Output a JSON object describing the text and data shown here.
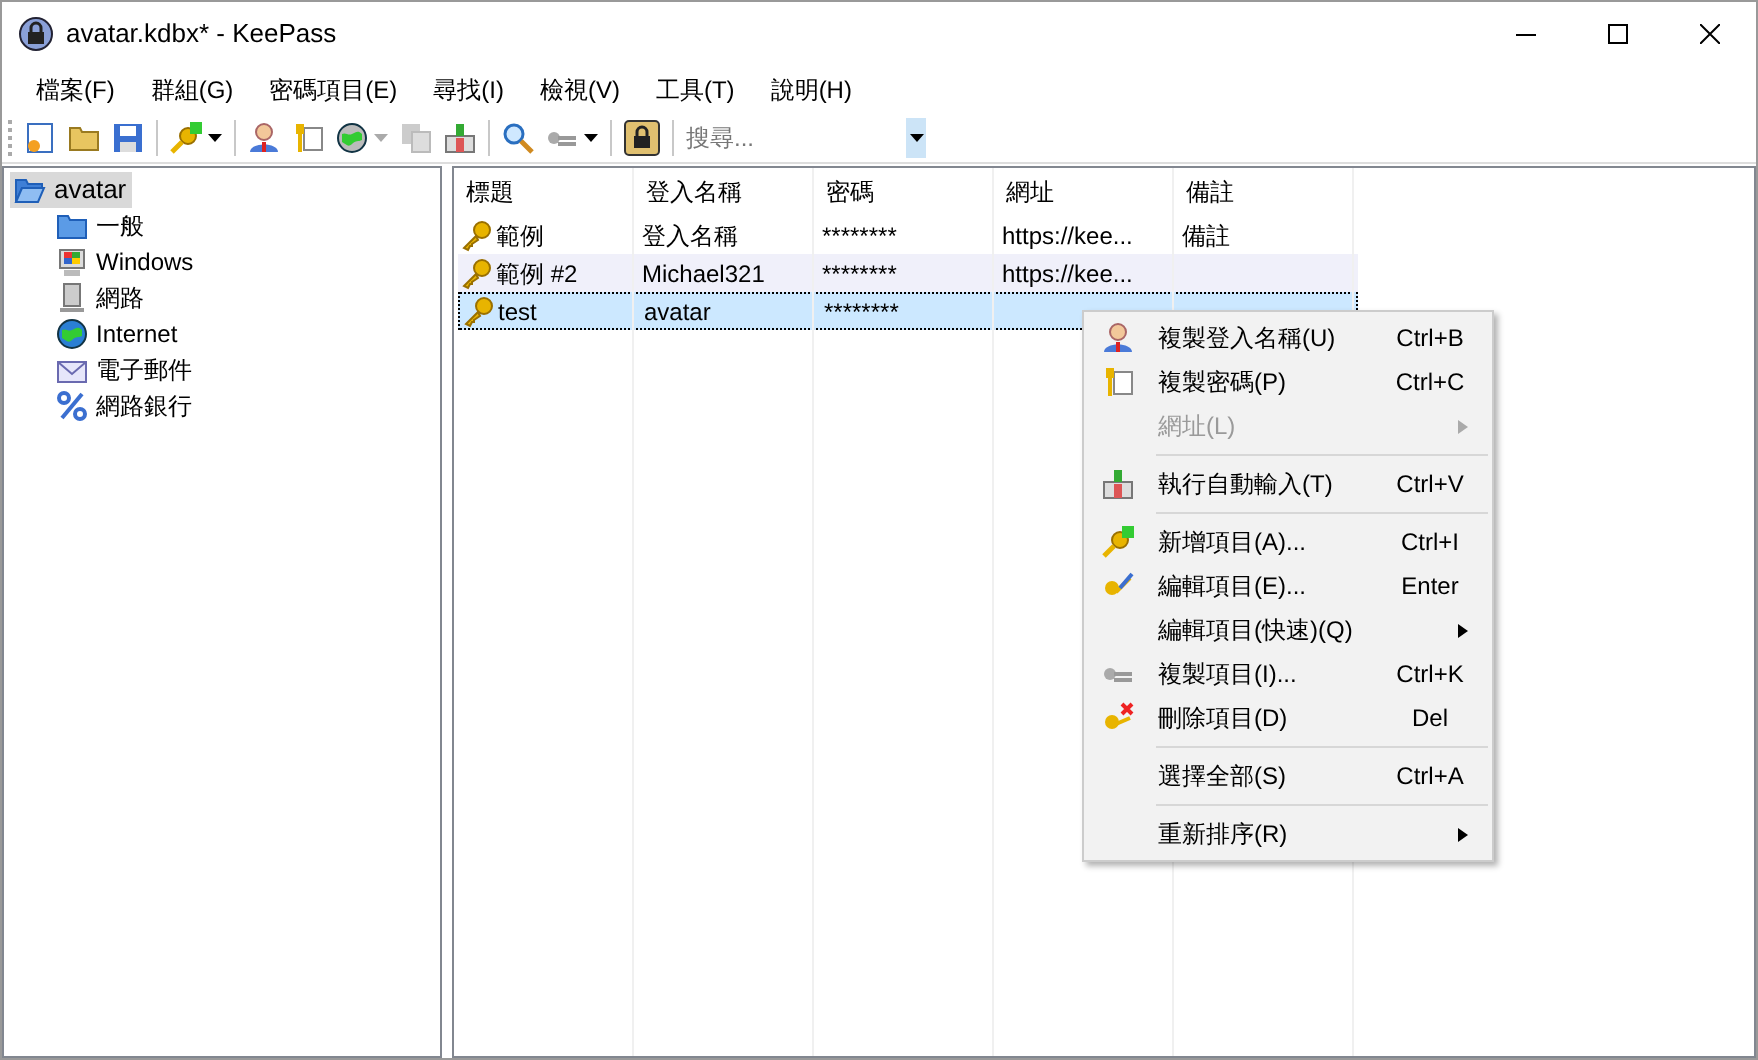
{
  "window": {
    "title": "avatar.kdbx* - KeePass"
  },
  "menu": [
    "檔案(F)",
    "群組(G)",
    "密碼項目(E)",
    "尋找(I)",
    "檢視(V)",
    "工具(T)",
    "說明(H)"
  ],
  "search": {
    "placeholder": "搜尋..."
  },
  "tree": {
    "label": "avatar",
    "selected": true,
    "expanded": true,
    "children": [
      {
        "label": "一般",
        "selected": false
      },
      {
        "label": "Windows",
        "selected": false
      },
      {
        "label": "網路",
        "selected": false
      },
      {
        "label": "Internet",
        "selected": false
      },
      {
        "label": "電子郵件",
        "selected": false
      },
      {
        "label": "網路銀行",
        "selected": false
      }
    ]
  },
  "table": {
    "columns": [
      "標題",
      "登入名稱",
      "密碼",
      "網址",
      "備註"
    ],
    "rows": [
      {
        "selected": false,
        "cells": [
          "範例",
          "登入名稱",
          "********",
          "https://kee...",
          "備註"
        ]
      },
      {
        "selected": false,
        "cells": [
          "範例 #2",
          "Michael321",
          "********",
          "https://kee...",
          ""
        ]
      },
      {
        "selected": true,
        "cells": [
          "test",
          "avatar",
          "********",
          "",
          ""
        ]
      }
    ]
  },
  "context_menu": [
    {
      "kind": "item",
      "label": "複製登入名稱(U)",
      "shortcut": "Ctrl+B",
      "disabled": false,
      "submenu": false
    },
    {
      "kind": "item",
      "label": "複製密碼(P)",
      "shortcut": "Ctrl+C",
      "disabled": false,
      "submenu": false
    },
    {
      "kind": "item",
      "label": "網址(L)",
      "disabled": true,
      "submenu": true
    },
    {
      "kind": "separator"
    },
    {
      "kind": "item",
      "label": "執行自動輸入(T)",
      "shortcut": "Ctrl+V",
      "disabled": false,
      "submenu": false
    },
    {
      "kind": "separator"
    },
    {
      "kind": "item",
      "label": "新增項目(A)...",
      "shortcut": "Ctrl+I",
      "disabled": false,
      "submenu": false
    },
    {
      "kind": "item",
      "label": "編輯項目(E)...",
      "shortcut": "Enter",
      "disabled": false,
      "submenu": false
    },
    {
      "kind": "item",
      "label": "編輯項目(快速)(Q)",
      "disabled": false,
      "submenu": true
    },
    {
      "kind": "item",
      "label": "複製項目(I)...",
      "shortcut": "Ctrl+K",
      "disabled": false,
      "submenu": false
    },
    {
      "kind": "item",
      "label": "刪除項目(D)",
      "shortcut": "Del",
      "disabled": false,
      "submenu": false
    },
    {
      "kind": "separator"
    },
    {
      "kind": "item",
      "label": "選擇全部(S)",
      "shortcut": "Ctrl+A",
      "disabled": false,
      "submenu": false
    },
    {
      "kind": "separator"
    },
    {
      "kind": "item",
      "label": "重新排序(R)",
      "disabled": false,
      "submenu": true
    }
  ]
}
